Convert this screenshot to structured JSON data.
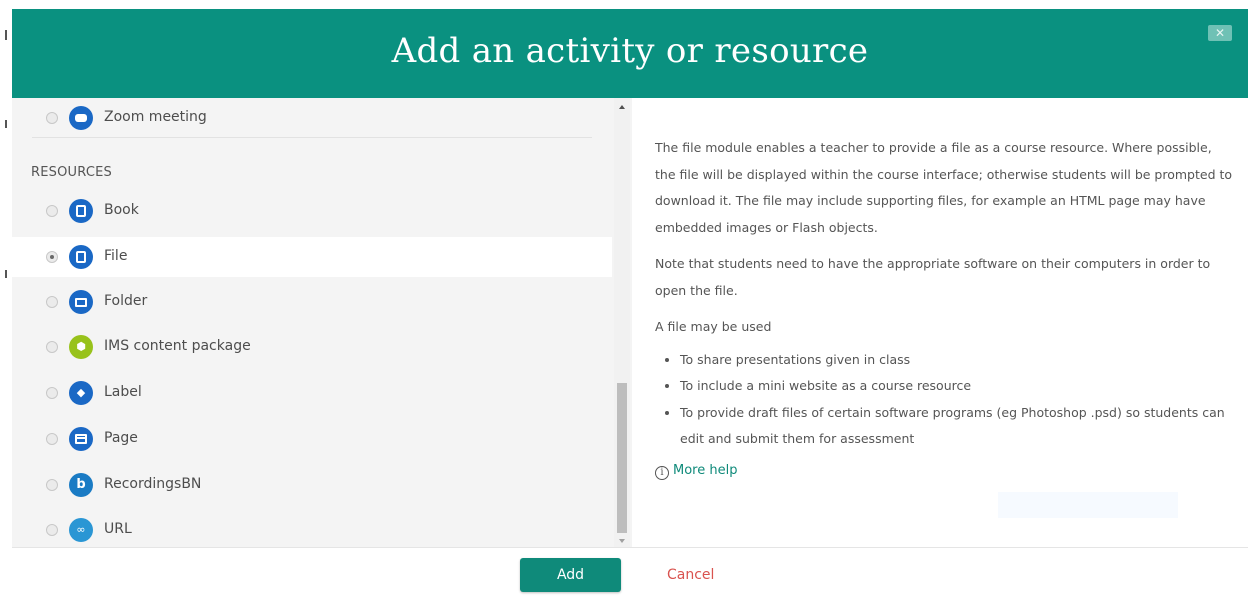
{
  "dialog": {
    "title": "Add an activity or resource",
    "close_icon": "close-icon"
  },
  "list": {
    "activities": [
      {
        "label": "Zoom meeting",
        "icon": "zoom-icon",
        "selected": false
      }
    ],
    "resources_heading": "RESOURCES",
    "resources": [
      {
        "label": "Book",
        "icon": "book-icon",
        "selected": false
      },
      {
        "label": "File",
        "icon": "file-icon",
        "selected": true
      },
      {
        "label": "Folder",
        "icon": "folder-icon",
        "selected": false
      },
      {
        "label": "IMS content package",
        "icon": "package-icon",
        "selected": false
      },
      {
        "label": "Label",
        "icon": "tag-icon",
        "selected": false
      },
      {
        "label": "Page",
        "icon": "page-icon",
        "selected": false
      },
      {
        "label": "RecordingsBN",
        "icon": "recordings-icon",
        "selected": false
      },
      {
        "label": "URL",
        "icon": "link-icon",
        "selected": false
      }
    ]
  },
  "help": {
    "paragraph1": "The file module enables a teacher to provide a file as a course resource. Where possible, the file will be displayed within the course interface; otherwise students will be prompted to download it. The file may include supporting files, for example an HTML page may have embedded images or Flash objects.",
    "paragraph2": "Note that students need to have the appropriate software on their computers in order to open the file.",
    "paragraph3": "A file may be used",
    "bullets": [
      "To share presentations given in class",
      "To include a mini website as a course resource",
      "To provide draft files of certain software programs (eg Photoshop .psd) so students can edit and submit them for assessment"
    ],
    "more_help": "More help"
  },
  "footer": {
    "add_label": "Add",
    "cancel_label": "Cancel"
  },
  "colors": {
    "header": "#0a9180",
    "accent": "#0f8a7a",
    "cancel": "#d9534f",
    "icon_blue": "#1a68c5",
    "icon_green": "#98c21b"
  }
}
